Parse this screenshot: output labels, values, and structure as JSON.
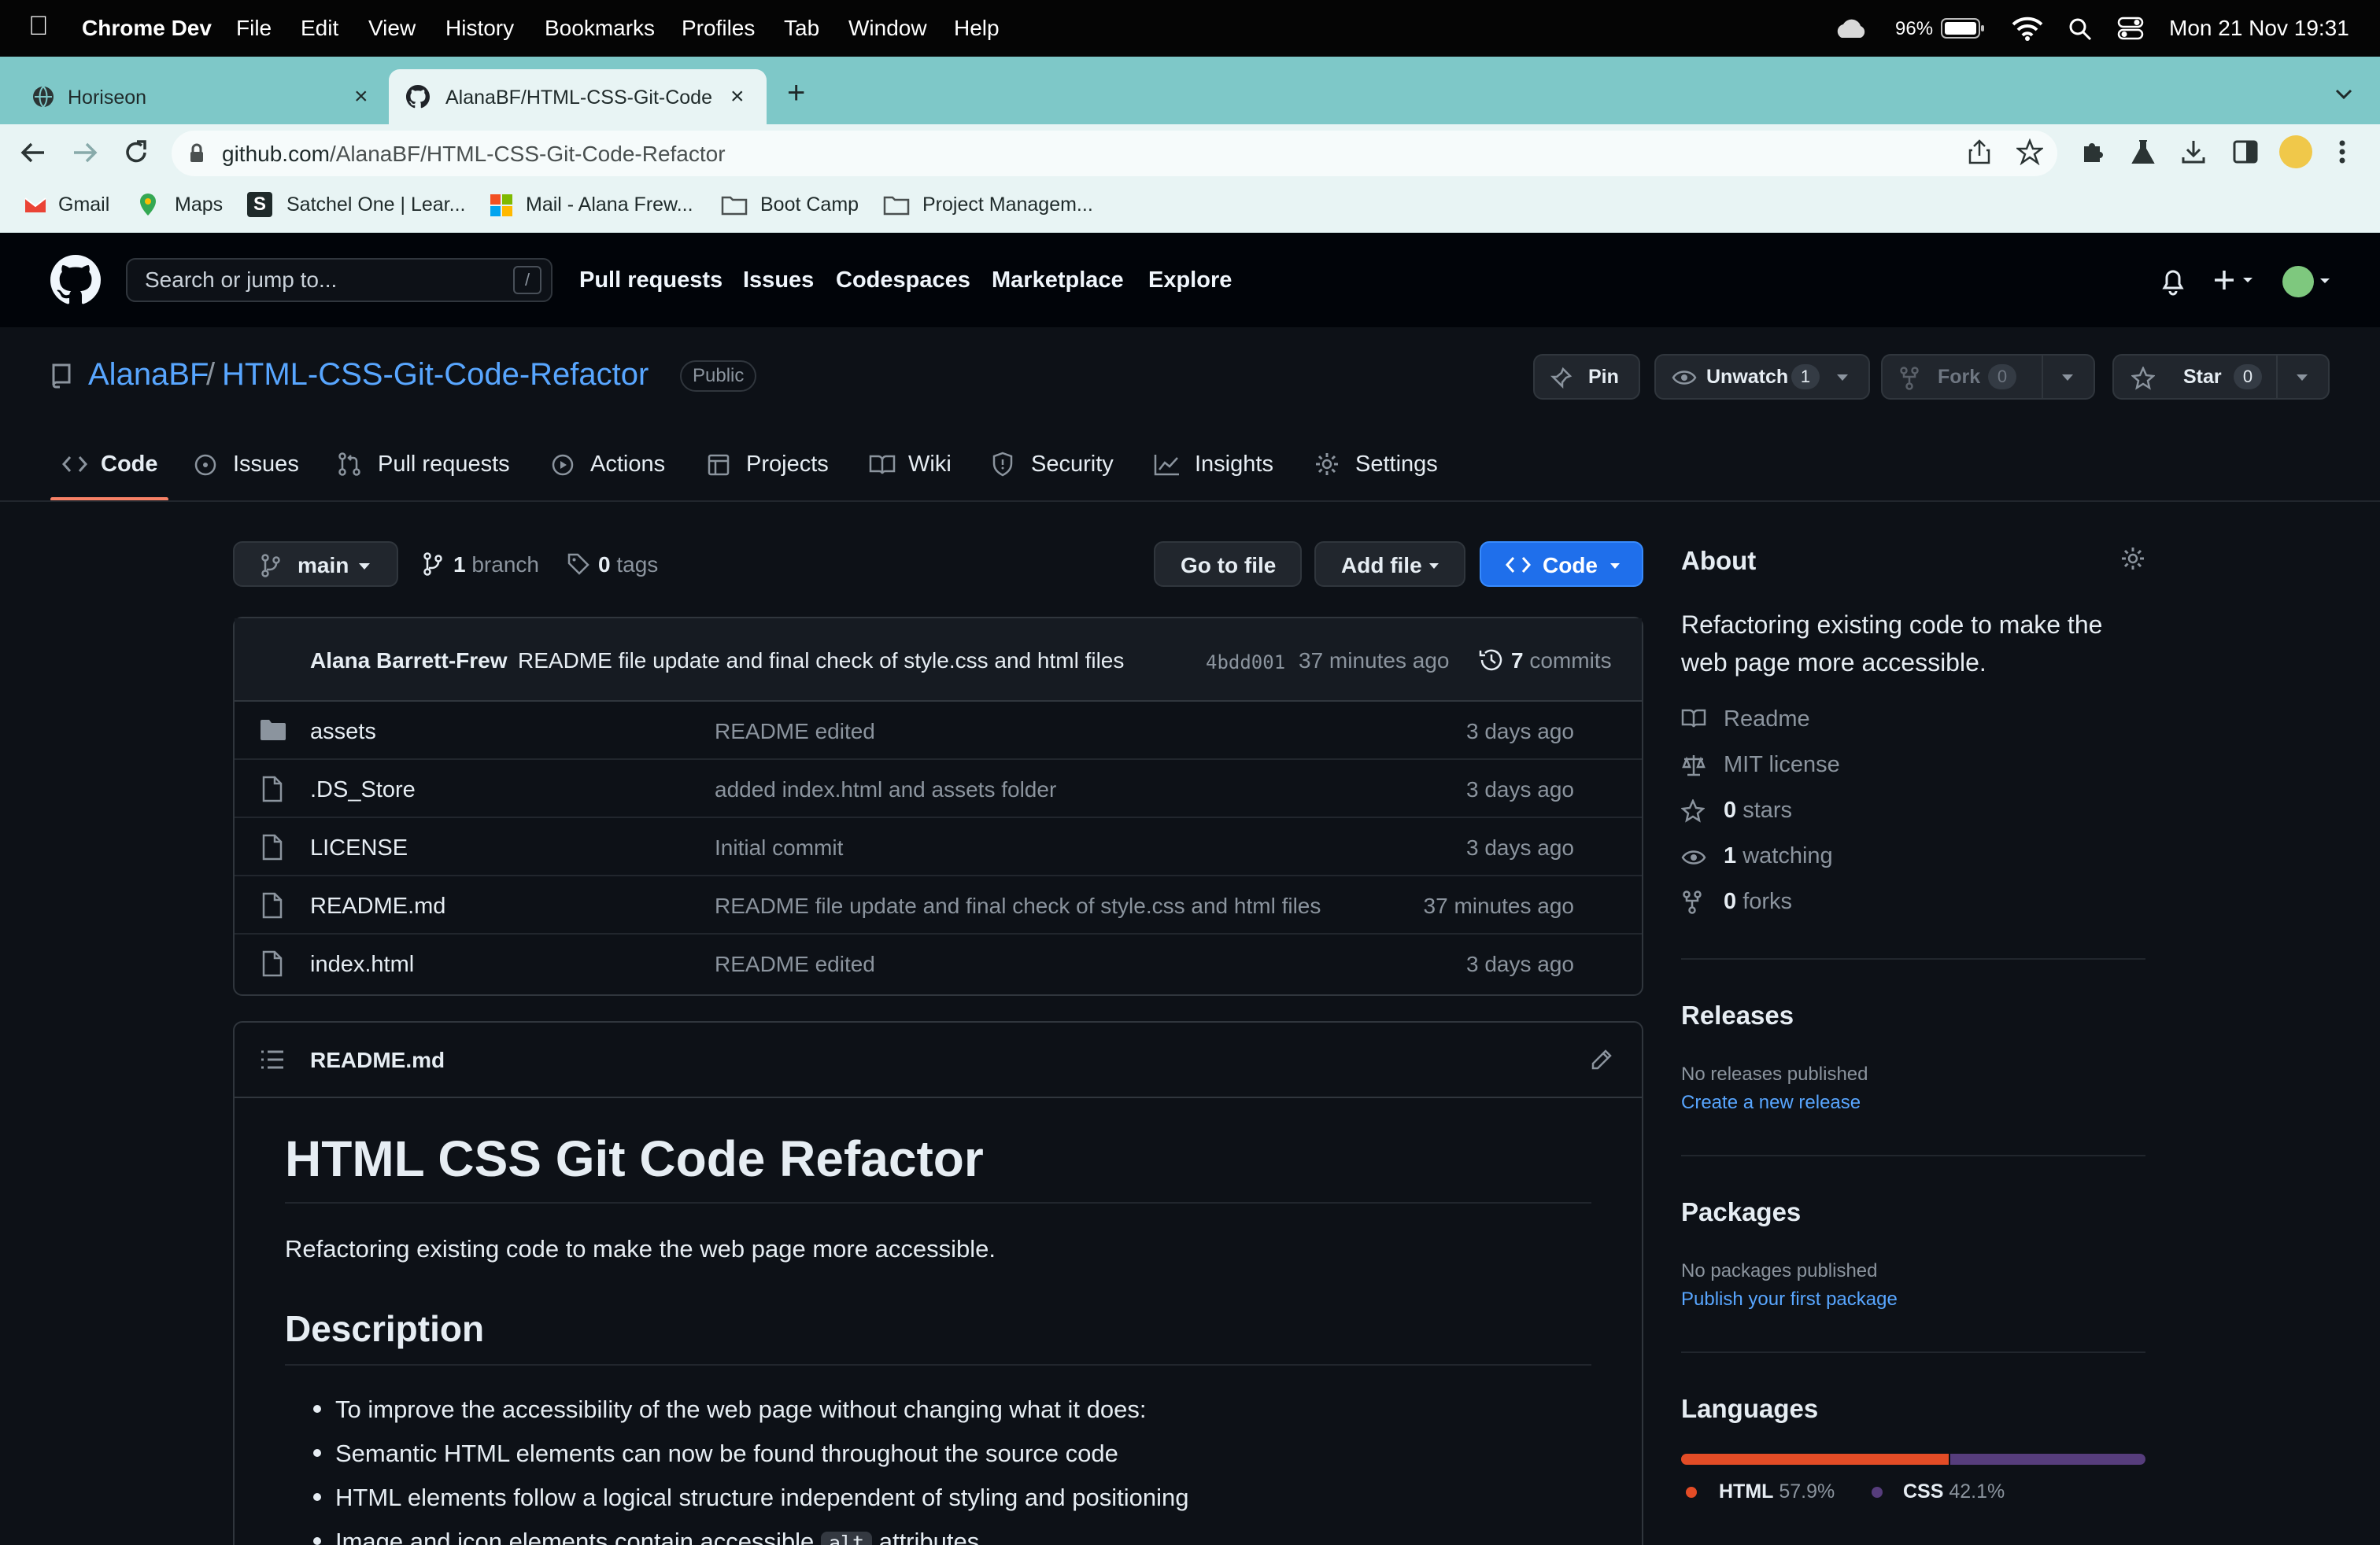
{
  "menubar": {
    "app": "Chrome Dev",
    "items": [
      "File",
      "Edit",
      "View",
      "History",
      "Bookmarks",
      "Profiles",
      "Tab",
      "Window",
      "Help"
    ],
    "battery": "96%",
    "datetime": "Mon 21 Nov  19:31"
  },
  "browser": {
    "tabs": [
      {
        "title": "Horiseon"
      },
      {
        "title": "AlanaBF/HTML-CSS-Git-Code-Refactor"
      }
    ],
    "url_host": "github.com",
    "url_path": "/AlanaBF/HTML-CSS-Git-Code-Refactor",
    "bookmarks": [
      "Gmail",
      "Maps",
      "Satchel One | Lear...",
      "Mail - Alana Frew...",
      "Boot Camp",
      "Project Managem..."
    ]
  },
  "github": {
    "search_placeholder": "Search or jump to...",
    "search_key": "/",
    "nav": [
      "Pull requests",
      "Issues",
      "Codespaces",
      "Marketplace",
      "Explore"
    ]
  },
  "repo": {
    "owner": "AlanaBF",
    "separator": "/",
    "name": "HTML-CSS-Git-Code-Refactor",
    "visibility": "Public",
    "actions": {
      "pin": "Pin",
      "unwatch": "Unwatch",
      "watch_count": "1",
      "fork": "Fork",
      "fork_count": "0",
      "star": "Star",
      "star_count": "0"
    },
    "tabs": [
      "Code",
      "Issues",
      "Pull requests",
      "Actions",
      "Projects",
      "Wiki",
      "Security",
      "Insights",
      "Settings"
    ],
    "branch": "main",
    "branch_count": "1",
    "branch_label": "branch",
    "tag_count": "0",
    "tag_label": "tags",
    "go_to_file": "Go to file",
    "add_file": "Add file",
    "code_button": "Code"
  },
  "commit": {
    "author": "Alana Barrett-Frew",
    "message": "README file update and final check of style.css and html files",
    "sha": "4bdd001",
    "age": "37 minutes ago",
    "count": "7",
    "count_label": "commits"
  },
  "files": [
    {
      "name": "assets",
      "type": "folder",
      "message": "README edited",
      "age": "3 days ago"
    },
    {
      "name": ".DS_Store",
      "type": "file",
      "message": "added index.html and assets folder",
      "age": "3 days ago"
    },
    {
      "name": "LICENSE",
      "type": "file",
      "message": "Initial commit",
      "age": "3 days ago"
    },
    {
      "name": "README.md",
      "type": "file",
      "message": "README file update and final check of style.css and html files",
      "age": "37 minutes ago"
    },
    {
      "name": "index.html",
      "type": "file",
      "message": "README edited",
      "age": "3 days ago"
    }
  ],
  "readme": {
    "filename": "README.md",
    "title": "HTML CSS Git Code Refactor",
    "intro": "Refactoring existing code to make the web page more accessible.",
    "description_heading": "Description",
    "bullets": [
      "To improve the accessibility of the web page without changing what it does:",
      "Semantic HTML elements can now be found throughout the source code",
      "HTML elements follow a logical structure independent of styling and positioning"
    ],
    "partial_bullet_before": "Image and icon elements contain accessible",
    "partial_bullet_code": "alt",
    "partial_bullet_after": "attributes"
  },
  "about": {
    "heading": "About",
    "description": "Refactoring existing code to make the web page more accessible.",
    "readme": "Readme",
    "license": "MIT license",
    "stars_count": "0",
    "stars_label": "stars",
    "watching_count": "1",
    "watching_label": "watching",
    "forks_count": "0",
    "forks_label": "forks"
  },
  "releases": {
    "heading": "Releases",
    "empty": "No releases published",
    "link": "Create a new release"
  },
  "packages": {
    "heading": "Packages",
    "empty": "No packages published",
    "link": "Publish your first package"
  },
  "languages": {
    "heading": "Languages",
    "items": [
      {
        "name": "HTML",
        "percent": "57.9%",
        "fraction": 0.579,
        "color": "#e34c26"
      },
      {
        "name": "CSS",
        "percent": "42.1%",
        "fraction": 0.421,
        "color": "#563d7c"
      }
    ]
  }
}
